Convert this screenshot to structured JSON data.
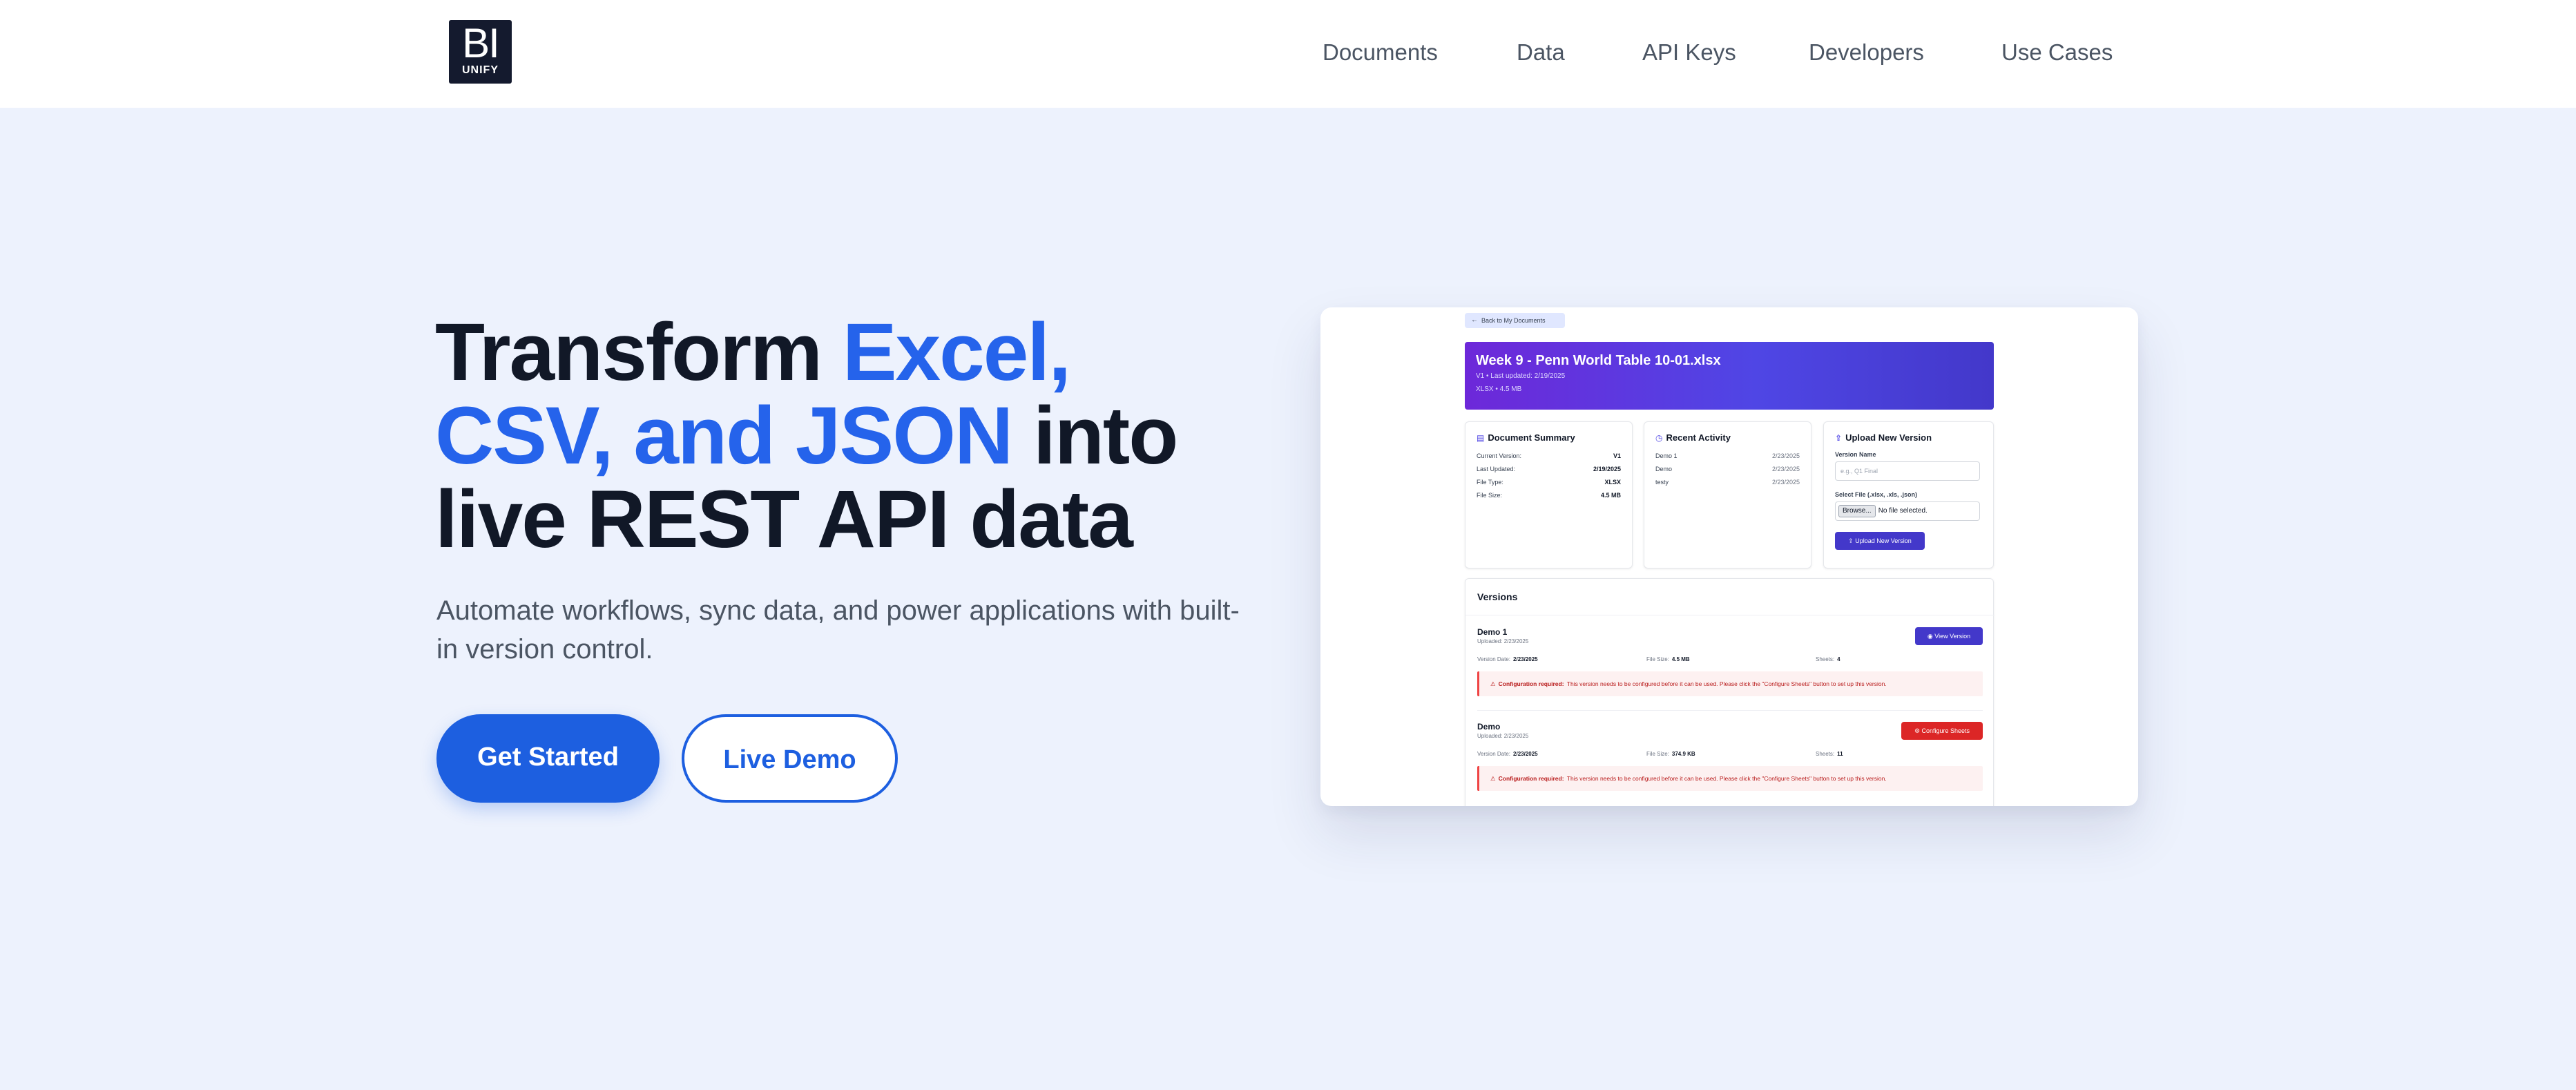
{
  "logo": {
    "top": "BI",
    "bottom": "UNIFY"
  },
  "nav": {
    "items": [
      "Documents",
      "Data",
      "API Keys",
      "Developers",
      "Use Cases"
    ]
  },
  "hero": {
    "title_part1": "Transform ",
    "title_accent": "Excel, CSV, and JSON",
    "title_part2": " into live REST API data",
    "subtitle": "Automate workflows, sync data, and power applications with built-in version control.",
    "primary_cta": "Get Started",
    "secondary_cta": "Live Demo"
  },
  "preview": {
    "back_link": "Back to My Documents",
    "doc": {
      "title": "Week 9 - Penn World Table 10-01.xlsx",
      "meta1": "V1 • Last updated: 2/19/2025",
      "meta2": "XLSX • 4.5 MB"
    },
    "summary": {
      "title": "Document Summary",
      "rows": [
        {
          "label": "Current Version:",
          "value": "V1"
        },
        {
          "label": "Last Updated:",
          "value": "2/19/2025"
        },
        {
          "label": "File Type:",
          "value": "XLSX"
        },
        {
          "label": "File Size:",
          "value": "4.5 MB"
        }
      ]
    },
    "activity": {
      "title": "Recent Activity",
      "rows": [
        {
          "name": "Demo 1",
          "date": "2/23/2025"
        },
        {
          "name": "Demo",
          "date": "2/23/2025"
        },
        {
          "name": "testy",
          "date": "2/23/2025"
        }
      ]
    },
    "upload": {
      "title": "Upload New Version",
      "name_label": "Version Name",
      "name_placeholder": "e.g., Q1 Final",
      "file_label": "Select File (.xlsx, .xls, .json)",
      "browse": "Browse...",
      "no_file": "No file selected.",
      "button": "Upload New Version"
    },
    "versions": {
      "title": "Versions",
      "items": [
        {
          "name": "Demo 1",
          "uploaded": "Uploaded: 2/23/2025",
          "button": "View Version",
          "date_label": "Version Date:",
          "date": "2/23/2025",
          "size_label": "File Size:",
          "size": "4.5 MB",
          "sheets_label": "Sheets:",
          "sheets": "4",
          "alert_title": "Configuration required:",
          "alert_text": "This version needs to be configured before it can be used. Please click the \"Configure Sheets\" button to set up this version."
        },
        {
          "name": "Demo",
          "uploaded": "Uploaded: 2/23/2025",
          "button": "Configure Sheets",
          "date_label": "Version Date:",
          "date": "2/23/2025",
          "size_label": "File Size:",
          "size": "374.9 KB",
          "sheets_label": "Sheets:",
          "sheets": "11",
          "alert_title": "Configuration required:",
          "alert_text": "This version needs to be configured before it can be used. Please click the \"Configure Sheets\" button to set up this version."
        }
      ]
    }
  }
}
